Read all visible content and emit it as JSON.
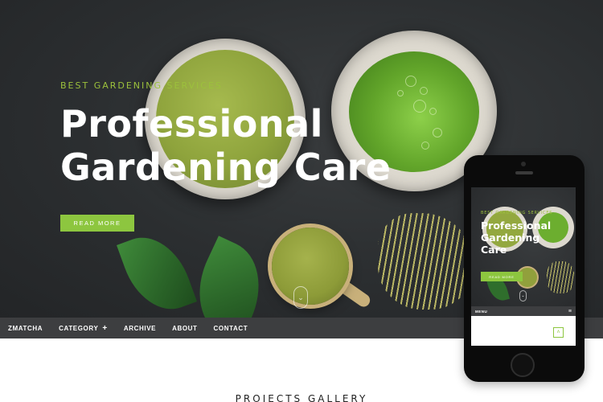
{
  "hero": {
    "subtitle": "BEST GARDENING SERVICES",
    "title_line1": "Professional",
    "title_line2": "Gardening Care",
    "cta_label": "READ MORE",
    "scroll_icon": "chevron-down-icon"
  },
  "nav": {
    "items": [
      "ZMATCHA",
      "CATEGORY",
      "ARCHIVE",
      "ABOUT",
      "CONTACT"
    ],
    "category_expand": "+"
  },
  "gallery": {
    "title": "PROJECTS GALLERY"
  },
  "phone": {
    "subtitle": "BEST GARDENING SERVICES",
    "title_line1": "Professional",
    "title_line2": "Gardening",
    "title_line3": "Care",
    "cta_label": "READ MORE",
    "menu_label": "MENU",
    "menu_icon": "hamburger-icon",
    "up_icon": "arrow-up-icon"
  },
  "colors": {
    "accent": "#8dc63f",
    "nav_bg": "#3d3e40",
    "hero_bg": "#2b2e30"
  }
}
